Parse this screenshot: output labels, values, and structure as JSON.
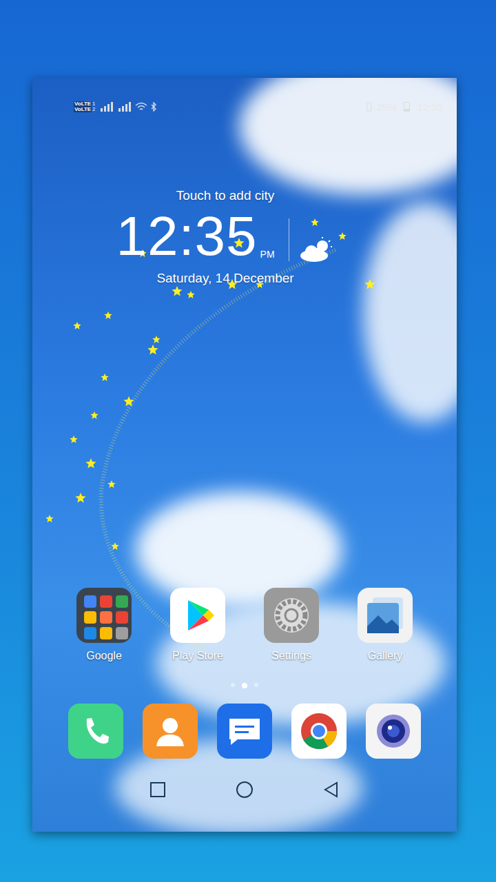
{
  "status_bar": {
    "sims": [
      {
        "badge": "VoLTE",
        "slot": "1"
      },
      {
        "badge": "VoLTE",
        "slot": "2"
      }
    ],
    "battery": "25%",
    "battery_level": 0.25,
    "time": "12:35"
  },
  "weather_widget": {
    "city_prompt": "Touch to add city",
    "time": "12:35",
    "meridiem": "PM",
    "date": "Saturday, 14 December"
  },
  "apps": [
    {
      "label": "Google",
      "kind": "folder"
    },
    {
      "label": "Play Store",
      "kind": "play"
    },
    {
      "label": "Settings",
      "kind": "settings"
    },
    {
      "label": "Gallery",
      "kind": "gallery"
    }
  ],
  "page_dots": [
    {
      "selected": false
    },
    {
      "selected": true
    },
    {
      "selected": false
    }
  ],
  "dock": [
    {
      "kind": "phone"
    },
    {
      "kind": "contacts"
    },
    {
      "kind": "messages"
    },
    {
      "kind": "chrome"
    },
    {
      "kind": "camera"
    }
  ],
  "nav_buttons": [
    {
      "kind": "recents"
    },
    {
      "kind": "home"
    },
    {
      "kind": "back"
    }
  ]
}
